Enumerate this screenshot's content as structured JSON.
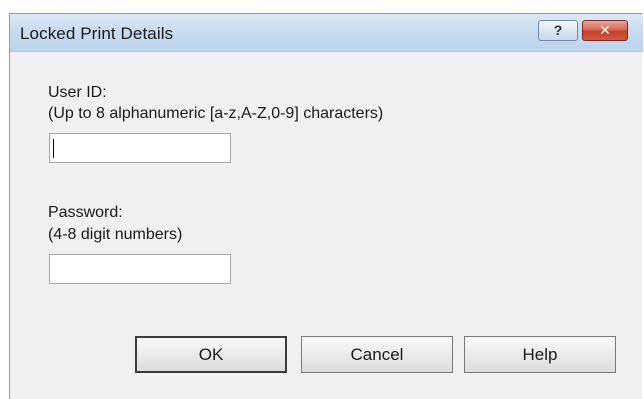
{
  "window": {
    "title": "Locked Print Details"
  },
  "titlebar": {
    "help_glyph": "?",
    "close_glyph": "✕"
  },
  "user_id": {
    "label": "User ID:",
    "hint": "(Up to 8 alphanumeric [a-z,A-Z,0-9] characters)",
    "value": ""
  },
  "password": {
    "label": "Password:",
    "hint": "(4-8 digit numbers)",
    "value": ""
  },
  "buttons": {
    "ok": "OK",
    "cancel": "Cancel",
    "help": "Help"
  },
  "colors": {
    "titlebar": "#c9dcf0",
    "close_button": "#c43f2a",
    "dialog_background": "#f0f0f0"
  }
}
